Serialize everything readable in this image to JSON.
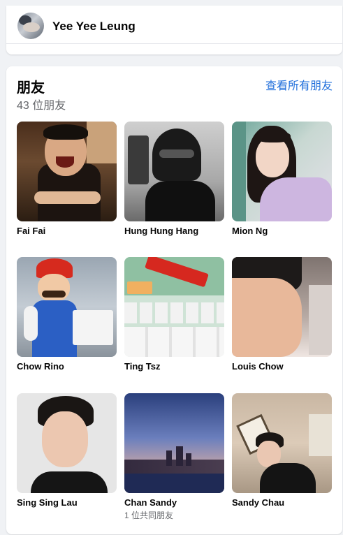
{
  "profile": {
    "name": "Yee Yee Leung"
  },
  "friends_section": {
    "title": "朋友",
    "count": "43 位朋友",
    "see_all": "查看所有朋友",
    "friends": [
      {
        "name": "Fai Fai"
      },
      {
        "name": "Hung Hung Hang"
      },
      {
        "name": "Mion Ng"
      },
      {
        "name": "Chow Rino"
      },
      {
        "name": "Ting Tsz"
      },
      {
        "name": "Louis Chow"
      },
      {
        "name": "Sing Sing Lau"
      },
      {
        "name": "Chan Sandy",
        "mutual": "1 位共同朋友"
      },
      {
        "name": "Sandy Chau"
      }
    ]
  },
  "colors": {
    "link": "#216fdb",
    "muted": "#65676b",
    "text": "#050505",
    "background": "#f0f2f5"
  }
}
